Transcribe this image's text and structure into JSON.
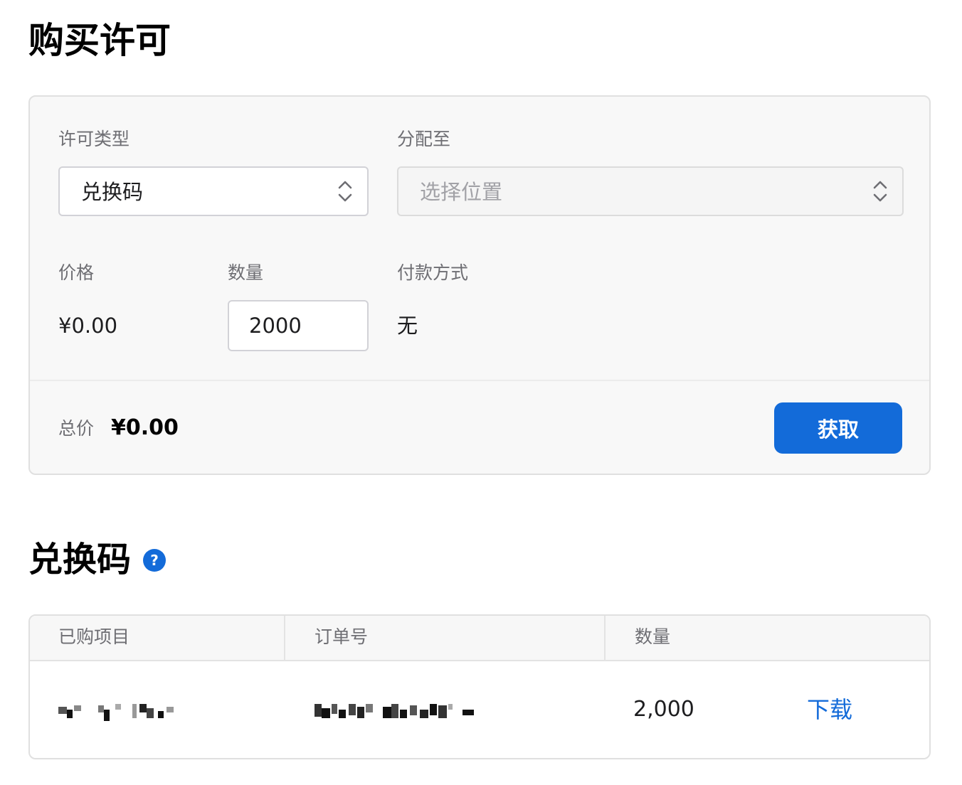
{
  "page": {
    "title": "购买许可"
  },
  "purchase_form": {
    "license_type": {
      "label": "许可类型",
      "value": "兑换码"
    },
    "assign_to": {
      "label": "分配至",
      "placeholder": "选择位置"
    },
    "price": {
      "label": "价格",
      "value": "¥0.00"
    },
    "quantity": {
      "label": "数量",
      "value": "2000"
    },
    "payment": {
      "label": "付款方式",
      "value": "无"
    },
    "total": {
      "label": "总价",
      "value": "¥0.00"
    },
    "get_button": {
      "label": "获取"
    },
    "accent_color": "#136bd9"
  },
  "codes_section": {
    "title": "兑换码",
    "help_icon": {
      "glyph": "?"
    },
    "table": {
      "headers": [
        "已购项目",
        "订单号",
        "数量"
      ],
      "rows": [
        {
          "item": "[redacted]",
          "order_number": "[redacted]",
          "quantity": "2,000",
          "action": "下载"
        }
      ]
    }
  }
}
